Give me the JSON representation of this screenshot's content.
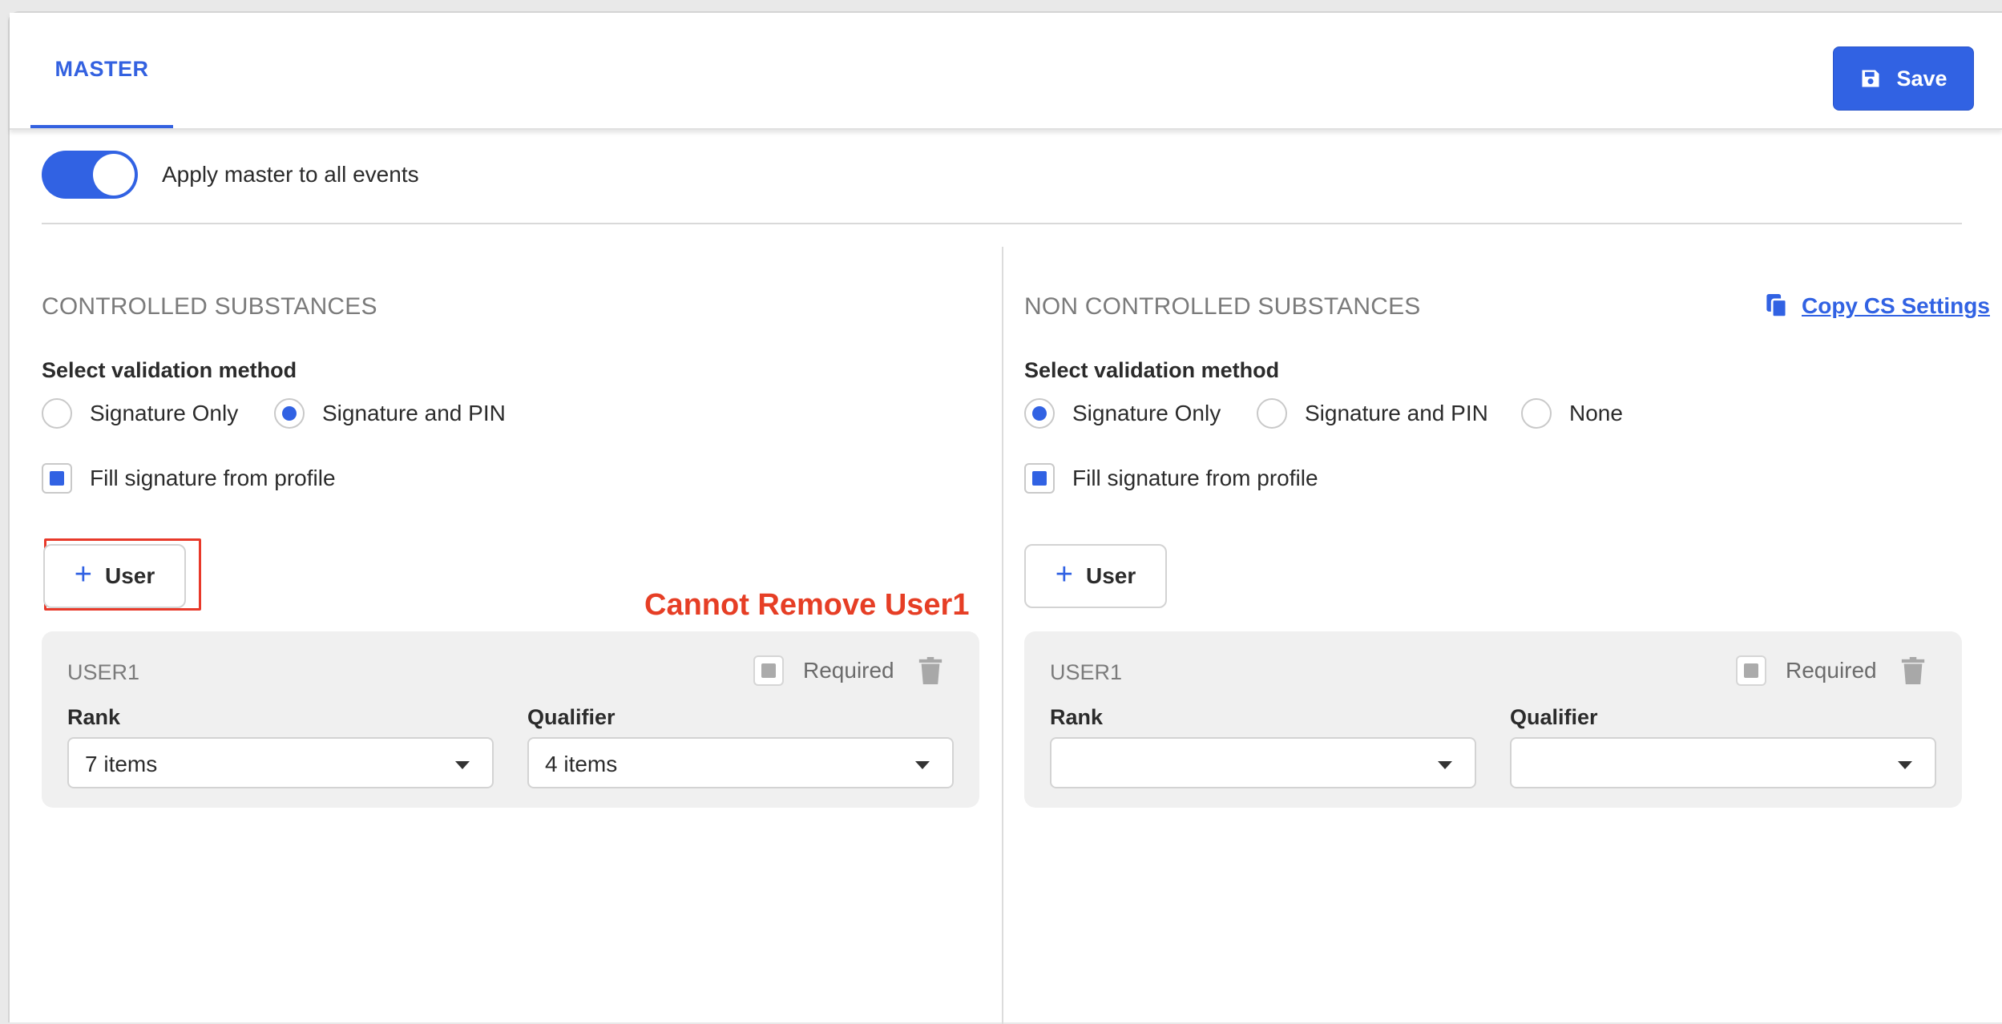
{
  "header": {
    "tab_label": "MASTER",
    "save_label": "Save",
    "save_icon": "floppy-disk-icon"
  },
  "apply_master": {
    "label": "Apply master to all events",
    "enabled": true
  },
  "controlled": {
    "title": "CONTROLLED SUBSTANCES",
    "validation_label": "Select validation method",
    "options": [
      {
        "label": "Signature Only",
        "selected": false
      },
      {
        "label": "Signature and PIN",
        "selected": true
      }
    ],
    "fill_signature_label": "Fill signature from profile",
    "fill_signature_checked": true,
    "add_user_label": "User",
    "annotation": "Cannot Remove User1",
    "user": {
      "name": "USER1",
      "required_label": "Required",
      "rank_label": "Rank",
      "rank_value": "7 items",
      "qualifier_label": "Qualifier",
      "qualifier_value": "4 items"
    }
  },
  "non_controlled": {
    "title": "NON CONTROLLED SUBSTANCES",
    "copy_link_label": "Copy CS Settings",
    "validation_label": "Select validation method",
    "options": [
      {
        "label": "Signature Only",
        "selected": true
      },
      {
        "label": "Signature and PIN",
        "selected": false
      },
      {
        "label": "None",
        "selected": false
      }
    ],
    "fill_signature_label": "Fill signature from profile",
    "fill_signature_checked": true,
    "add_user_label": "User",
    "user": {
      "name": "USER1",
      "required_label": "Required",
      "rank_label": "Rank",
      "rank_value": "",
      "qualifier_label": "Qualifier",
      "qualifier_value": ""
    }
  },
  "colors": {
    "accent": "#3162e3",
    "annotation": "#e63e25"
  }
}
